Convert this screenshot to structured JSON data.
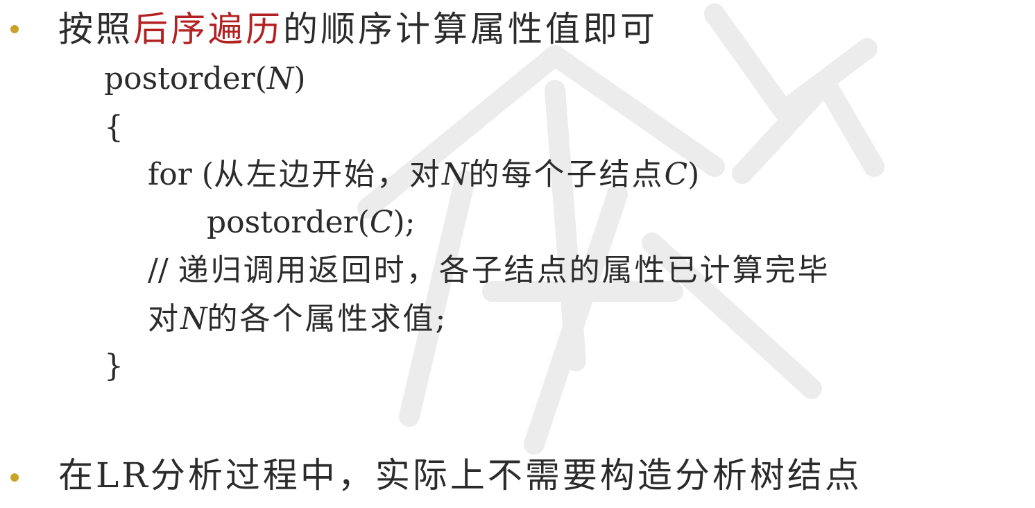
{
  "bullets": [
    {
      "before": "按照",
      "highlight": "后序遍历",
      "after": "的顺序计算属性值即可"
    },
    {
      "text": "在LR分析过程中，实际上不需要构造分析树结点"
    }
  ],
  "code": {
    "func_name": "postorder(",
    "func_arg": "N",
    "func_close": ")",
    "open_brace": "{",
    "for_kw": "for (",
    "for_cjk1": "从左边开始，对",
    "for_n": "N",
    "for_cjk2": "的每个子结点",
    "for_c": "C",
    "for_close": ")",
    "call_name": "postorder(",
    "call_arg": "C",
    "call_close": ");",
    "comment_slash": "//",
    "comment_text": "递归调用返回时，各子结点的属性已计算完毕",
    "eval_cjk1": "对",
    "eval_n": "N",
    "eval_cjk2": "的各个属性求值",
    "eval_semicolon": ";",
    "close_brace": "}"
  },
  "colors": {
    "bullet": "#c9a227",
    "highlight": "#b22222",
    "text": "#2b2b2b"
  }
}
